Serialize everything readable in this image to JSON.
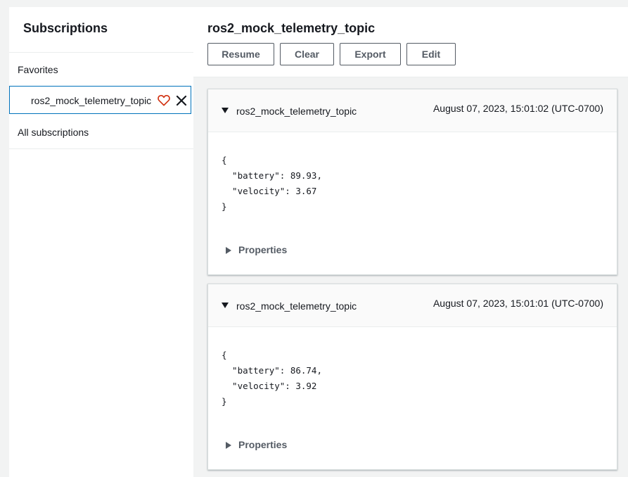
{
  "sidebar": {
    "title": "Subscriptions",
    "favorites_label": "Favorites",
    "favorite_item": {
      "label": "ros2_mock_telemetry_topic",
      "heart_icon": "heart-outline-icon",
      "close_icon": "close-icon",
      "heart_color": "#d13212"
    },
    "all_subscriptions_label": "All subscriptions"
  },
  "main": {
    "title": "ros2_mock_telemetry_topic",
    "buttons": {
      "resume": "Resume",
      "clear": "Clear",
      "export": "Export",
      "edit": "Edit"
    },
    "messages": [
      {
        "topic": "ros2_mock_telemetry_topic",
        "timestamp": "August 07, 2023, 15:01:02 (UTC-0700)",
        "payload": "{\n  \"battery\": 89.93,\n  \"velocity\": 3.67\n}",
        "properties_label": "Properties"
      },
      {
        "topic": "ros2_mock_telemetry_topic",
        "timestamp": "August 07, 2023, 15:01:01 (UTC-0700)",
        "payload": "{\n  \"battery\": 86.74,\n  \"velocity\": 3.92\n}",
        "properties_label": "Properties"
      }
    ]
  },
  "colors": {
    "accent": "#0073bb",
    "text": "#16191f",
    "button_text": "#545b64",
    "page_bg": "#f2f3f3"
  }
}
